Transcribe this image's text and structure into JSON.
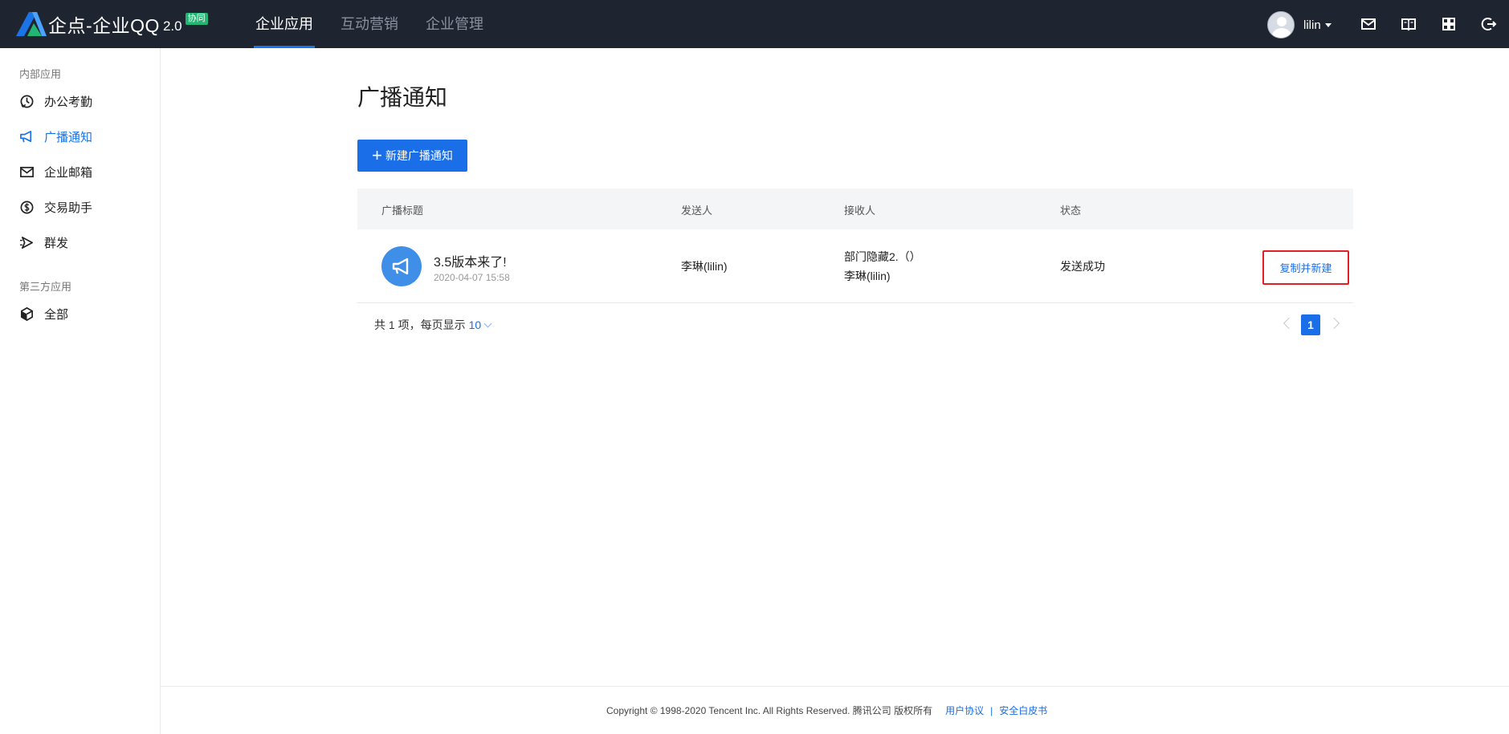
{
  "app": {
    "logo_text": "企点-企业QQ",
    "logo_version": "2.0",
    "logo_badge": "协同"
  },
  "nav": {
    "items": [
      {
        "label": "企业应用",
        "active": true
      },
      {
        "label": "互动营销",
        "active": false
      },
      {
        "label": "企业管理",
        "active": false
      }
    ]
  },
  "user": {
    "name": "lilin",
    "icons": [
      "mail-icon",
      "book-icon",
      "grid-apps-icon",
      "logout-icon"
    ]
  },
  "sidebar": {
    "internal_group": "内部应用",
    "internal_items": [
      {
        "label": "办公考勤",
        "icon": "clock-check-icon"
      },
      {
        "label": "广播通知",
        "icon": "megaphone-icon",
        "active": true
      },
      {
        "label": "企业邮箱",
        "icon": "mail-icon"
      },
      {
        "label": "交易助手",
        "icon": "currency-icon"
      },
      {
        "label": "群发",
        "icon": "send-icon"
      }
    ],
    "third_party_group": "第三方应用",
    "third_party_items": [
      {
        "label": "全部",
        "icon": "cube-icon"
      }
    ]
  },
  "main": {
    "title": "广播通知",
    "new_button": "新建广播通知",
    "table": {
      "headers": [
        "广播标题",
        "发送人",
        "接收人",
        "状态"
      ],
      "rows": [
        {
          "title": "3.5版本来了!",
          "time": "2020-04-07 15:58",
          "sender": "李琳(lilin)",
          "receiver_line1": "部门隐藏2.（）",
          "receiver_line2": "李琳(lilin)",
          "status": "发送成功",
          "action": "复制并新建"
        }
      ]
    },
    "pagination": {
      "total_text": "共 1 项，每页显示",
      "page_size": "10",
      "current_page": "1"
    }
  },
  "footer": {
    "copyright": "Copyright © 1998-2020 Tencent Inc. All Rights Reserved. 腾讯公司 版权所有",
    "link1": "用户协议",
    "separator": "|",
    "link2": "安全白皮书"
  },
  "colors": {
    "topbar": "#1f2530",
    "accent": "#1a6fe8",
    "highlight_border": "#e31e24"
  }
}
